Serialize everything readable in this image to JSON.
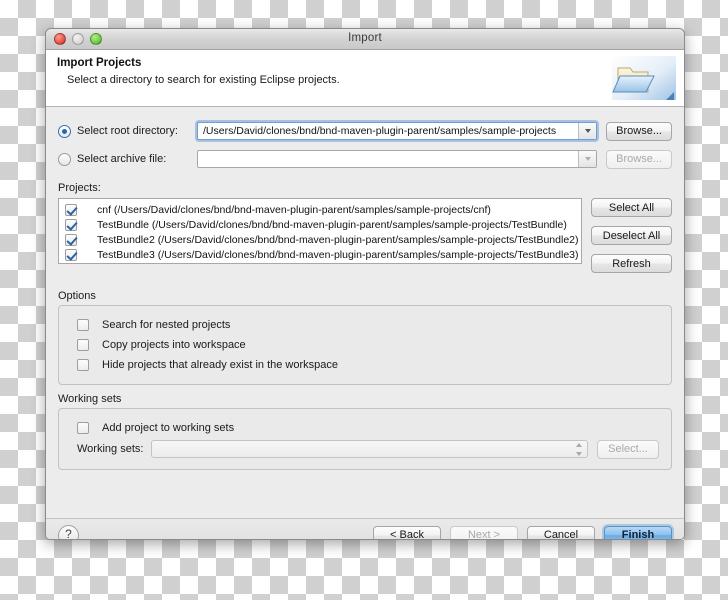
{
  "window": {
    "title": "Import",
    "controls": {
      "close": "close-button",
      "minimize": "minimize-button",
      "zoom": "zoom-button"
    }
  },
  "header": {
    "title": "Import Projects",
    "subtitle": "Select a directory to search for existing Eclipse projects.",
    "icon": "import-folder-icon"
  },
  "source": {
    "root_radio_label": "Select root directory:",
    "root_radio_selected": true,
    "root_value": "/Users/David/clones/bnd/bnd-maven-plugin-parent/samples/sample-projects",
    "root_browse_label": "Browse...",
    "archive_radio_label": "Select archive file:",
    "archive_radio_selected": false,
    "archive_value": "",
    "archive_browse_label": "Browse..."
  },
  "projects": {
    "label": "Projects:",
    "items": [
      {
        "label": "cnf (/Users/David/clones/bnd/bnd-maven-plugin-parent/samples/sample-projects/cnf)",
        "checked": true
      },
      {
        "label": "TestBundle (/Users/David/clones/bnd/bnd-maven-plugin-parent/samples/sample-projects/TestBundle)",
        "checked": true
      },
      {
        "label": "TestBundle2 (/Users/David/clones/bnd/bnd-maven-plugin-parent/samples/sample-projects/TestBundle2)",
        "checked": true
      },
      {
        "label": "TestBundle3 (/Users/David/clones/bnd/bnd-maven-plugin-parent/samples/sample-projects/TestBundle3)",
        "checked": true
      }
    ],
    "select_all_label": "Select All",
    "deselect_all_label": "Deselect All",
    "refresh_label": "Refresh"
  },
  "options": {
    "title": "Options",
    "items": [
      {
        "label": "Search for nested projects",
        "checked": false
      },
      {
        "label": "Copy projects into workspace",
        "checked": false
      },
      {
        "label": "Hide projects that already exist in the workspace",
        "checked": false
      }
    ]
  },
  "working_sets": {
    "title": "Working sets",
    "add_checkbox_label": "Add project to working sets",
    "add_checkbox_checked": false,
    "combo_label": "Working sets:",
    "combo_value": "",
    "select_label": "Select..."
  },
  "footer": {
    "help_label": "?",
    "back_label": "< Back",
    "next_label": "Next >",
    "cancel_label": "Cancel",
    "finish_label": "Finish"
  },
  "colors": {
    "accent": "#6aaae6",
    "check": "#2b62a8",
    "window_bg": "#ececec",
    "panel_bg": "#eaeaea"
  }
}
